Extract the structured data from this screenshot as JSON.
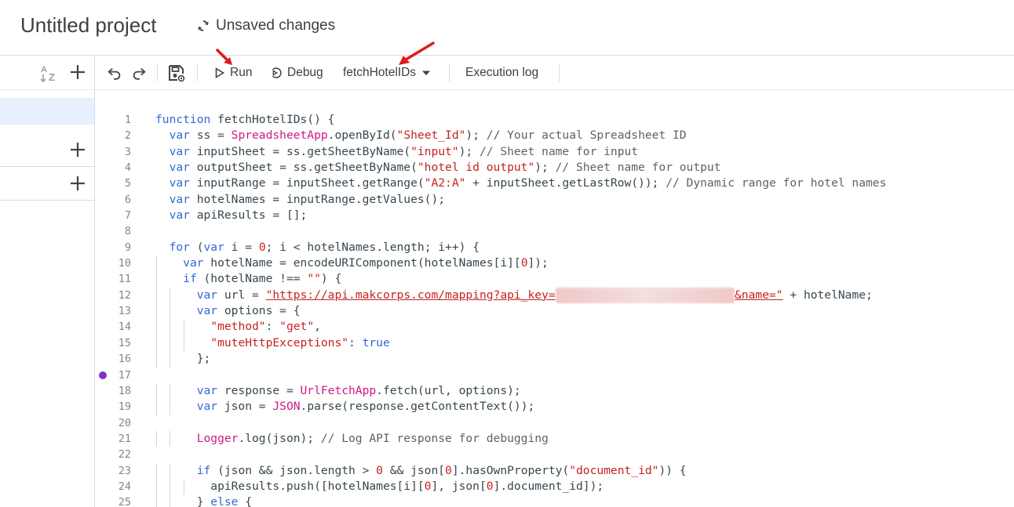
{
  "header": {
    "project_title": "Untitled project",
    "status": "Unsaved changes"
  },
  "toolbar": {
    "run_label": "Run",
    "debug_label": "Debug",
    "function_select": "fetchHotelIDs",
    "execution_log_label": "Execution log"
  },
  "code": {
    "lines": [
      {
        "n": "1",
        "html": "<span class=\"kw\">function</span> fetchHotelIDs() {"
      },
      {
        "n": "2",
        "html": "  <span class=\"kw\">var</span> ss = <span class=\"cls\">SpreadsheetApp</span>.openById(<span class=\"str\">\"Sheet_Id\"</span>); <span class=\"com\">// Your actual Spreadsheet ID</span>"
      },
      {
        "n": "3",
        "html": "  <span class=\"kw\">var</span> inputSheet = ss.getSheetByName(<span class=\"str\">\"input\"</span>); <span class=\"com\">// Sheet name for input</span>"
      },
      {
        "n": "4",
        "html": "  <span class=\"kw\">var</span> outputSheet = ss.getSheetByName(<span class=\"str\">\"hotel id output\"</span>); <span class=\"com\">// Sheet name for output</span>"
      },
      {
        "n": "5",
        "html": "  <span class=\"kw\">var</span> inputRange = inputSheet.getRange(<span class=\"str\">\"A2:A\"</span> + inputSheet.getLastRow()); <span class=\"com\">// Dynamic range for hotel names</span>"
      },
      {
        "n": "6",
        "html": "  <span class=\"kw\">var</span> hotelNames = inputRange.getValues();"
      },
      {
        "n": "7",
        "html": "  <span class=\"kw\">var</span> apiResults = [];"
      },
      {
        "n": "8",
        "html": ""
      },
      {
        "n": "9",
        "html": "  <span class=\"kw\">for</span> (<span class=\"kw\">var</span> i = <span class=\"num\">0</span>; i &lt; hotelNames.length; i++) {"
      },
      {
        "n": "10",
        "html": "    <span class=\"kw\">var</span> hotelName = encodeURIComponent(hotelNames[i][<span class=\"num\">0</span>]);"
      },
      {
        "n": "11",
        "html": "    <span class=\"kw\">if</span> (hotelName !== <span class=\"str\">\"\"</span>) {"
      },
      {
        "n": "12",
        "html": "      <span class=\"kw\">var</span> url = <span class=\"url\">\"https://api.makcorps.com/mapping?api_key=<span class=\"blur\">xxxxxxxxxxxxxxxxxxxxxxxxxx</span>&amp;name=\"</span> + hotelName;"
      },
      {
        "n": "13",
        "html": "      <span class=\"kw\">var</span> options = {"
      },
      {
        "n": "14",
        "html": "        <span class=\"str\">\"method\"</span>: <span class=\"str\">\"get\"</span>,"
      },
      {
        "n": "15",
        "html": "        <span class=\"str\">\"muteHttpExceptions\"</span>: <span class=\"kw\">true</span>"
      },
      {
        "n": "16",
        "html": "      };"
      },
      {
        "n": "17",
        "html": "",
        "breakpoint": true
      },
      {
        "n": "18",
        "html": "      <span class=\"kw\">var</span> response = <span class=\"cls\">UrlFetchApp</span>.fetch(url, options);"
      },
      {
        "n": "19",
        "html": "      <span class=\"kw\">var</span> json = <span class=\"cls\">JSON</span>.parse(response.getContentText());"
      },
      {
        "n": "20",
        "html": ""
      },
      {
        "n": "21",
        "html": "      <span class=\"cls\">Logger</span>.log(json); <span class=\"com\">// Log API response for debugging</span>"
      },
      {
        "n": "22",
        "html": ""
      },
      {
        "n": "23",
        "html": "      <span class=\"kw\">if</span> (json &amp;&amp; json.length &gt; <span class=\"num\">0</span> &amp;&amp; json[<span class=\"num\">0</span>].hasOwnProperty(<span class=\"str\">\"document_id\"</span>)) {"
      },
      {
        "n": "24",
        "html": "        apiResults.push([hotelNames[i][<span class=\"num\">0</span>], json[<span class=\"num\">0</span>].document_id]);"
      },
      {
        "n": "25",
        "html": "      } <span class=\"kw\">else</span> {"
      }
    ]
  },
  "colors": {
    "accent_selection": "#e8f0fe",
    "breakpoint": "#8430ce",
    "annotation_arrow": "#e01b1b"
  }
}
